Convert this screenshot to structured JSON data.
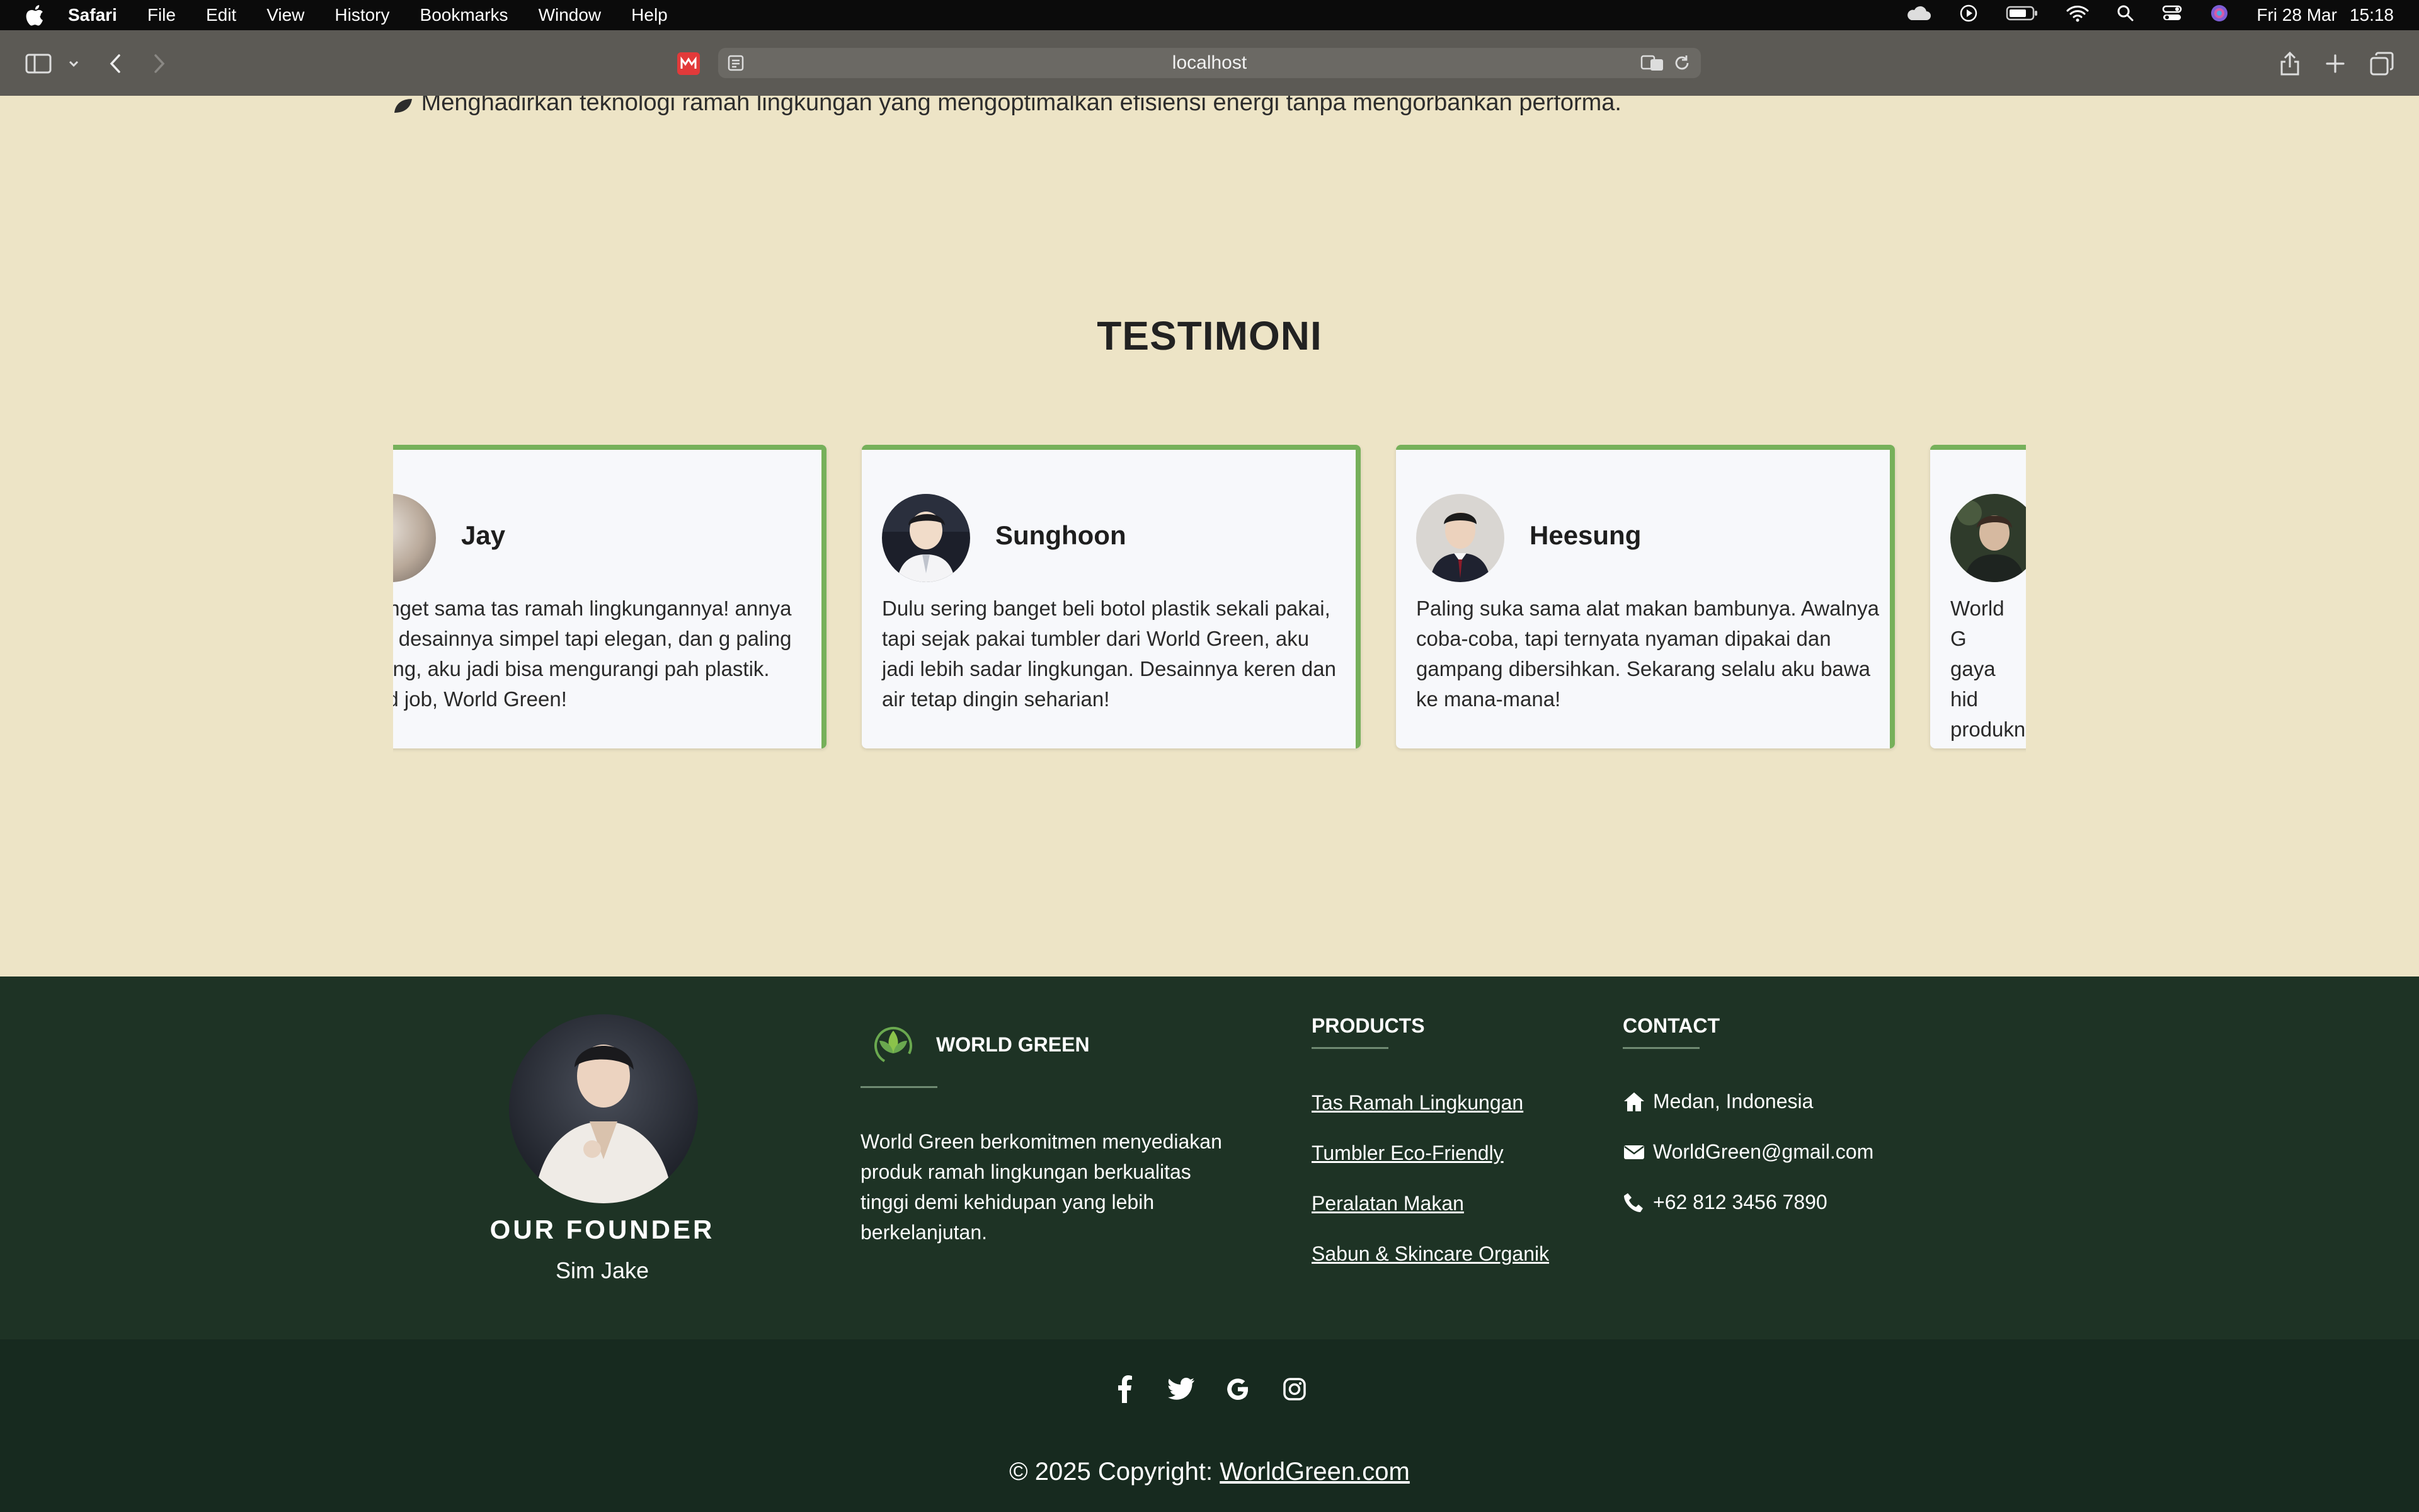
{
  "menubar": {
    "app_name": "Safari",
    "menus": [
      "File",
      "Edit",
      "View",
      "History",
      "Bookmarks",
      "Window",
      "Help"
    ],
    "date": "Fri 28 Mar",
    "time": "15:18"
  },
  "browser": {
    "url": "localhost"
  },
  "page": {
    "cut_off_line": "Menghadirkan teknologi ramah lingkungan yang mengoptimalkan efisiensi energi tanpa mengorbankan performa.",
    "testimonial_title": "TESTIMONI",
    "testimonials": [
      {
        "name": "Jay",
        "text": "a banget sama tas ramah lingkungannya! annya kuat, desainnya simpel tapi elegan, dan g paling penting, aku jadi bisa mengurangi pah plastik. Good job, World Green!"
      },
      {
        "name": "Sunghoon",
        "text": "Dulu sering banget beli botol plastik sekali pakai, tapi sejak pakai tumbler dari World Green, aku jadi lebih sadar lingkungan. Desainnya keren dan air tetap dingin seharian!"
      },
      {
        "name": "Heesung",
        "text": "Paling suka sama alat makan bambunya. Awalnya coba-coba, tapi ternyata nyaman dipakai dan gampang dibersihkan. Sekarang selalu aku bawa ke mana-mana!"
      },
      {
        "name": "",
        "text": "World G gaya hid produkn"
      }
    ]
  },
  "footer": {
    "founder_title": "OUR FOUNDER",
    "founder_name": "Sim Jake",
    "brand_name": "WORLD GREEN",
    "brand_description": "World Green berkomitmen menyediakan produk ramah lingkungan berkualitas tinggi demi kehidupan yang lebih berkelanjutan.",
    "products_title": "PRODUCTS",
    "products": [
      "Tas Ramah Lingkungan",
      "Tumbler Eco-Friendly",
      "Peralatan Makan",
      "Sabun & Skincare Organik"
    ],
    "contact_title": "CONTACT",
    "contact": {
      "address": "Medan, Indonesia",
      "email": "WorldGreen@gmail.com",
      "phone": "+62 812 3456 7890"
    },
    "socials": [
      "facebook-icon",
      "twitter-icon",
      "google-icon",
      "instagram-icon"
    ],
    "copyright_prefix": "© 2025 Copyright: ",
    "copyright_link": "WorldGreen.com"
  },
  "colors": {
    "page_bg": "#ede4c6",
    "card_accent": "#76b05a",
    "footer_bg": "#1e3325",
    "bottom_bar_bg": "#172a1f"
  }
}
